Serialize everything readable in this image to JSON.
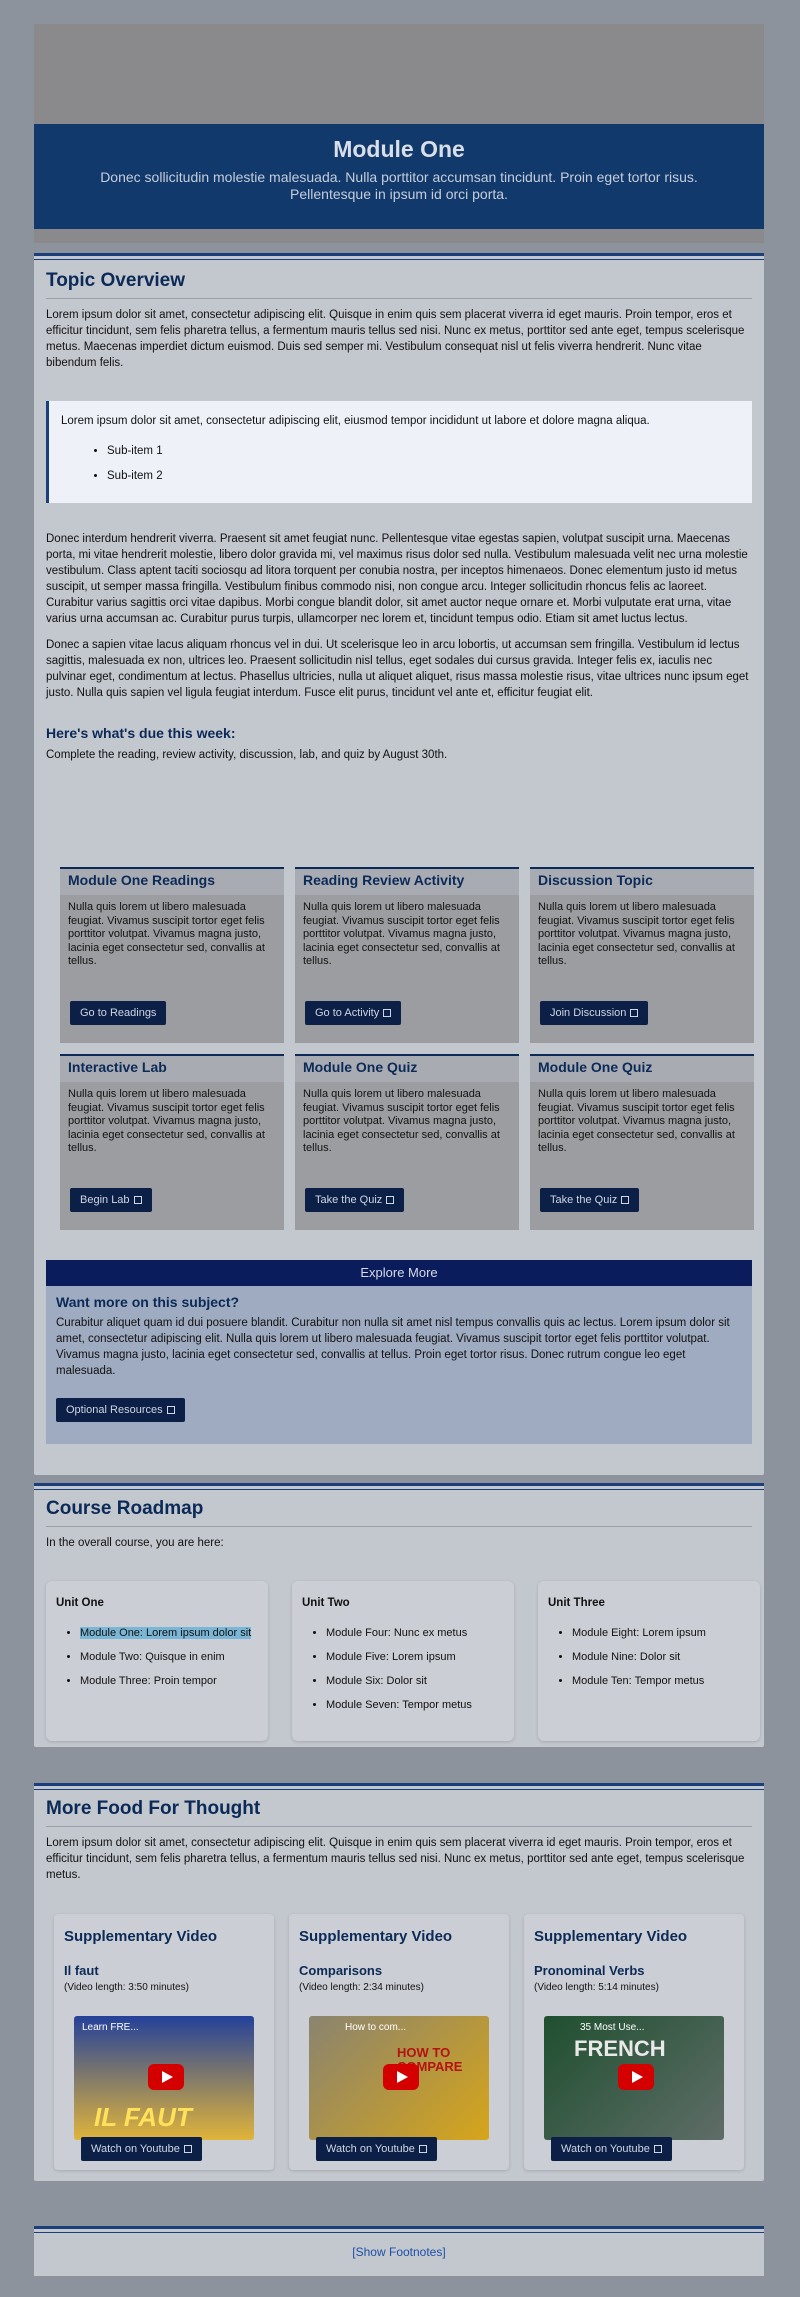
{
  "header": {
    "title": "Module One",
    "subtitle": "Donec sollicitudin molestie malesuada. Nulla porttitor accumsan tincidunt. Proin eget tortor risus. Pellentesque in ipsum id orci porta."
  },
  "overview": {
    "heading": "Topic Overview",
    "p1": "Lorem ipsum dolor sit amet, consectetur adipiscing elit. Quisque in enim quis sem placerat viverra id eget mauris. Proin tempor, eros et efficitur tincidunt, sem felis pharetra tellus, a fermentum mauris tellus sed nisi. Nunc ex metus, porttitor sed ante eget, tempus scelerisque metus. Maecenas imperdiet dictum euismod. Duis sed semper mi. Vestibulum consequat nisl ut felis viverra hendrerit. Nunc vitae bibendum felis.",
    "callout_text": "Lorem ipsum dolor sit amet, consectetur adipiscing elit, eiusmod tempor incididunt ut labore et dolore magna aliqua.",
    "callout_items": [
      "Sub-item 1",
      "Sub-item 2"
    ],
    "p2": "Donec interdum hendrerit viverra. Praesent sit amet feugiat nunc. Pellentesque vitae egestas sapien, volutpat suscipit urna. Maecenas porta, mi vitae hendrerit molestie, libero dolor gravida mi, vel maximus risus dolor sed nulla. Vestibulum malesuada velit nec urna molestie vestibulum. Class aptent taciti sociosqu ad litora torquent per conubia nostra, per inceptos himenaeos. Donec elementum justo id metus suscipit, ut semper massa fringilla. Vestibulum finibus commodo nisi, non congue arcu. Integer sollicitudin rhoncus felis ac laoreet. Curabitur varius sagittis orci vitae dapibus. Morbi congue blandit dolor, sit amet auctor neque ornare et. Morbi vulputate erat urna, vitae varius urna accumsan ac. Curabitur purus turpis, ullamcorper nec lorem et, tincidunt tempus odio. Etiam sit amet luctus lectus.",
    "p3": "Donec a sapien vitae lacus aliquam rhoncus vel in dui. Ut scelerisque leo in arcu lobortis, ut accumsan sem fringilla. Vestibulum id lectus sagittis, malesuada ex non, ultrices leo. Praesent sollicitudin nisl tellus, eget sodales dui cursus gravida. Integer felis ex, iaculis nec pulvinar eget, condimentum at lectus. Phasellus ultricies, nulla ut aliquet aliquet, risus massa molestie risus, vitae ultrices nunc ipsum eget justo. Nulla quis sapien vel ligula feugiat interdum. Fusce elit purus, tincidunt vel ante et, efficitur feugiat elit.",
    "due_heading": "Here's what's due this week:",
    "due_text": "Complete the reading, review activity, discussion, lab, and quiz by August 30th."
  },
  "tiles": [
    {
      "title": "Module One Readings",
      "body": "Nulla quis lorem ut libero malesuada feugiat. Vivamus suscipit tortor eget felis porttitor volutpat. Vivamus magna justo, lacinia eget consectetur sed, convallis at tellus.",
      "button": "Go to Readings"
    },
    {
      "title": "Reading Review Activity",
      "body": "Nulla quis lorem ut libero malesuada feugiat. Vivamus suscipit tortor eget felis porttitor volutpat. Vivamus magna justo, lacinia eget consectetur sed, convallis at tellus.",
      "button": "Go to Activity"
    },
    {
      "title": "Discussion Topic",
      "body": "Nulla quis lorem ut libero malesuada feugiat. Vivamus suscipit tortor eget felis porttitor volutpat. Vivamus magna justo, lacinia eget consectetur sed, convallis at tellus.",
      "button": "Join Discussion"
    },
    {
      "title": "Interactive Lab",
      "body": "Nulla quis lorem ut libero malesuada feugiat. Vivamus suscipit tortor eget felis porttitor volutpat. Vivamus magna justo, lacinia eget consectetur sed, convallis at tellus.",
      "button": "Begin Lab"
    },
    {
      "title": "Module One Quiz",
      "body": "Nulla quis lorem ut libero malesuada feugiat. Vivamus suscipit tortor eget felis porttitor volutpat. Vivamus magna justo, lacinia eget consectetur sed, convallis at tellus.",
      "button": "Take the Quiz"
    },
    {
      "title": "Module One Quiz",
      "body": "Nulla quis lorem ut libero malesuada feugiat. Vivamus suscipit tortor eget felis porttitor volutpat. Vivamus magna justo, lacinia eget consectetur sed, convallis at tellus.",
      "button": "Take the Quiz"
    }
  ],
  "explore": {
    "header": "Explore More",
    "question": "Want more on this subject?",
    "body": "Curabitur aliquet quam id dui posuere blandit. Curabitur non nulla sit amet nisl tempus convallis quis ac lectus. Lorem ipsum dolor sit amet, consectetur adipiscing elit. Nulla quis lorem ut libero malesuada feugiat. Vivamus suscipit tortor eget felis porttitor volutpat. Vivamus magna justo, lacinia eget consectetur sed, convallis at tellus. Proin eget tortor risus. Donec rutrum congue leo eget malesuada.",
    "button": "Optional Resources"
  },
  "roadmap": {
    "heading": "Course Roadmap",
    "intro": "In the overall course, you are here:",
    "units": [
      {
        "title": "Unit One",
        "items": [
          "Module One: Lorem ipsum dolor sit",
          "Module Two: Quisque in enim",
          "Module Three: Proin tempor"
        ]
      },
      {
        "title": "Unit Two",
        "items": [
          "Module Four: Nunc ex metus",
          "Module Five: Lorem ipsum",
          "Module Six: Dolor sit",
          "Module Seven: Tempor metus"
        ]
      },
      {
        "title": "Unit Three",
        "items": [
          "Module Eight: Lorem ipsum",
          "Module Nine: Dolor sit",
          "Module Ten: Tempor metus"
        ]
      }
    ]
  },
  "food": {
    "heading": "More Food For Thought",
    "body": "Lorem ipsum dolor sit amet, consectetur adipiscing elit. Quisque in enim quis sem placerat viverra id eget mauris. Proin tempor, eros et efficitur tincidunt, sem felis pharetra tellus, a fermentum mauris tellus sed nisi. Nunc ex metus, porttitor sed ante eget, tempus scelerisque metus.",
    "videos": [
      {
        "title": "Supplementary Video",
        "subtitle": "Il faut",
        "length": "(Video length: 3:50 minutes)",
        "thumb_caption": "Learn FRE...",
        "thumb_overlay": "IL FAUT",
        "button": "Watch on Youtube"
      },
      {
        "title": "Supplementary Video",
        "subtitle": "Comparisons",
        "length": "(Video length: 2:34 minutes)",
        "thumb_caption": "How to com...",
        "thumb_overlay": "HOW TO COMPARE",
        "button": "Watch on Youtube"
      },
      {
        "title": "Supplementary Video",
        "subtitle": "Pronominal Verbs",
        "length": "(Video length: 5:14 minutes)",
        "thumb_caption": "35 Most Use...",
        "thumb_overlay": "FRENCH",
        "button": "Watch on Youtube"
      }
    ]
  },
  "footer": {
    "link": "[Show Footnotes]"
  }
}
